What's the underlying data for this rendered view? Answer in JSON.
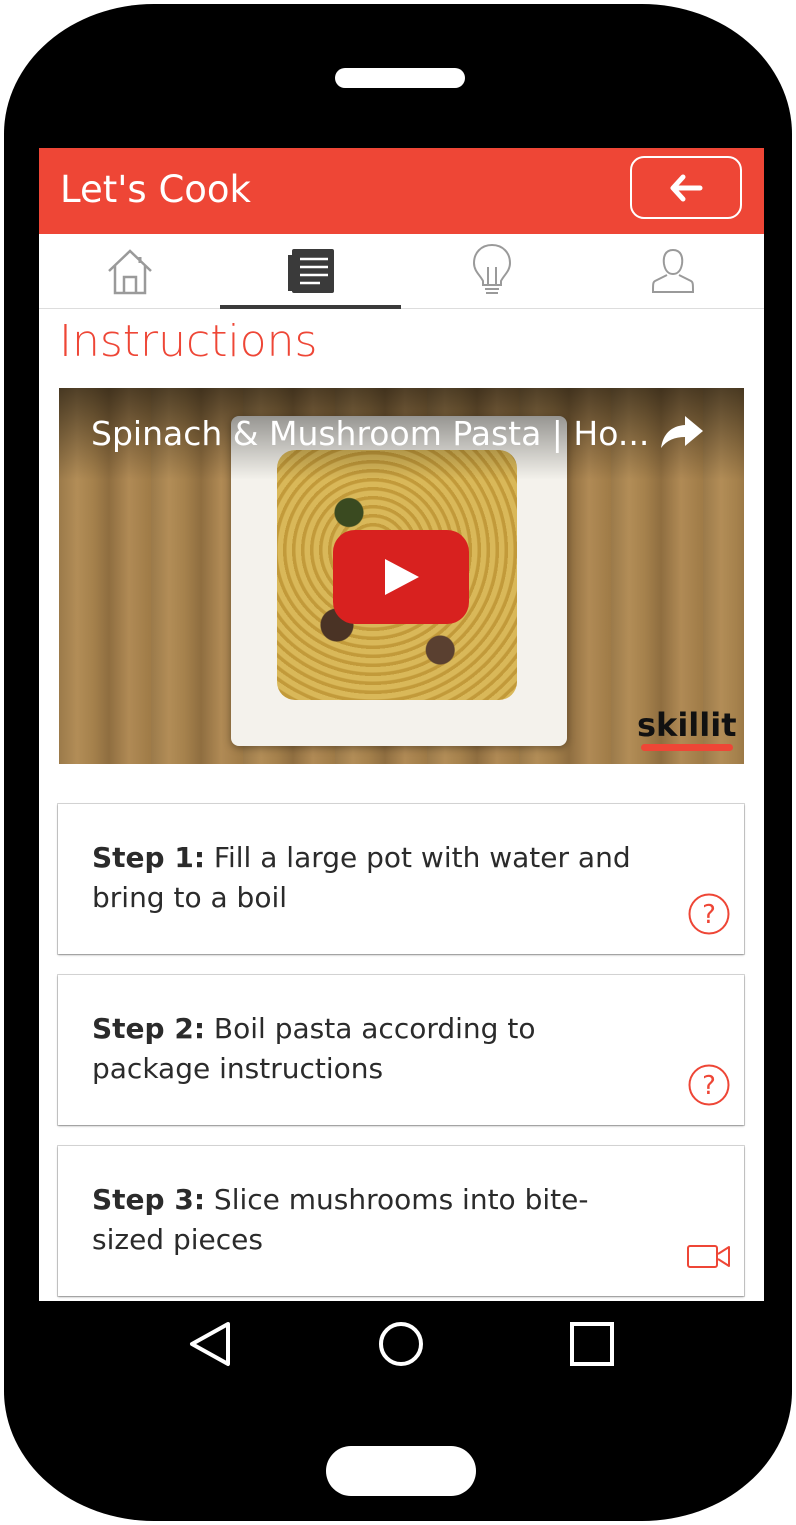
{
  "app": {
    "title": "Let's Cook"
  },
  "tabs": [
    {
      "icon": "home-icon"
    },
    {
      "icon": "recipe-list-icon",
      "active": true
    },
    {
      "icon": "lightbulb-icon"
    },
    {
      "icon": "user-icon"
    }
  ],
  "section": {
    "title": "Instructions"
  },
  "video": {
    "title": "Spinach & Mushroom Pasta | Ho...",
    "brand": "skillit"
  },
  "steps": [
    {
      "label": "Step 1:",
      "text": "Fill a large pot with water and bring to a boil",
      "icon": "help-icon"
    },
    {
      "label": "Step 2:",
      "text": "Boil pasta according to package instructions",
      "icon": "help-icon"
    },
    {
      "label": "Step 3:",
      "text": "Slice mushrooms into bite-sized pieces",
      "icon": "video-camera-icon"
    }
  ],
  "colors": {
    "accent": "#ee4636",
    "play": "#d8211f",
    "text": "#2b2b2b"
  }
}
